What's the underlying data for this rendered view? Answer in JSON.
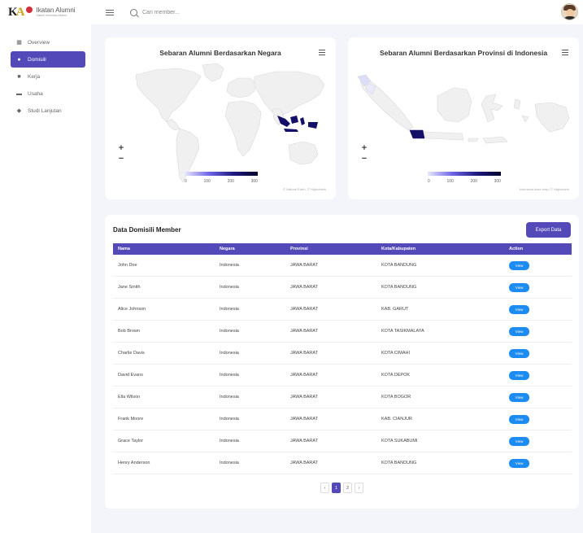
{
  "header": {
    "brand_title": "Ikatan Alumni",
    "brand_subtitle": "Sistem Informasi Alumni",
    "search_placeholder": "Cari member..."
  },
  "sidebar": {
    "items": [
      {
        "label": "Overview",
        "icon": "grid-icon"
      },
      {
        "label": "Domisili",
        "icon": "globe-icon"
      },
      {
        "label": "Kerja",
        "icon": "briefcase-icon"
      },
      {
        "label": "Usaha",
        "icon": "store-icon"
      },
      {
        "label": "Studi Lanjutan",
        "icon": "graduation-icon"
      }
    ],
    "active_index": 1
  },
  "map_world": {
    "title": "Sebaran Alumni Berdasarkan Negara",
    "zoom_in": "+",
    "zoom_out": "−",
    "legend_ticks": [
      "0",
      "100",
      "200",
      "300"
    ],
    "credits": "© Natural Earth, © Highcharts"
  },
  "map_indonesia": {
    "title": "Sebaran Alumni Berdasarkan Provinsi di Indonesia",
    "zoom_in": "+",
    "zoom_out": "−",
    "legend_ticks": [
      "0",
      "100",
      "200",
      "300"
    ],
    "credits": "Indonesia base map, © Highcharts"
  },
  "table": {
    "title": "Data Domisili Member",
    "export_label": "Export Data",
    "columns": [
      "Nama",
      "Negara",
      "Provinsi",
      "Kota/Kabupaten",
      "Action"
    ],
    "view_label": "View",
    "rows": [
      [
        "John Doe",
        "Indonesia",
        "JAWA BARAT",
        "KOTA BANDUNG"
      ],
      [
        "Jane Smith",
        "Indonesia",
        "JAWA BARAT",
        "KOTA BANDUNG"
      ],
      [
        "Alice Johnson",
        "Indonesia",
        "JAWA BARAT",
        "KAB. GARUT"
      ],
      [
        "Bob Brown",
        "Indonesia",
        "JAWA BARAT",
        "KOTA TASIKMALAYA"
      ],
      [
        "Charlie Davis",
        "Indonesia",
        "JAWA BARAT",
        "KOTA CIMAHI"
      ],
      [
        "David Evans",
        "Indonesia",
        "JAWA BARAT",
        "KOTA DEPOK"
      ],
      [
        "Ella Wilson",
        "Indonesia",
        "JAWA BARAT",
        "KOTA BOGOR"
      ],
      [
        "Frank Moore",
        "Indonesia",
        "JAWA BARAT",
        "KAB. CIANJUR"
      ],
      [
        "Grace Taylor",
        "Indonesia",
        "JAWA BARAT",
        "KOTA SUKABUMI"
      ],
      [
        "Henry Anderson",
        "Indonesia",
        "JAWA BARAT",
        "KOTA BANDUNG"
      ]
    ]
  },
  "pagination": {
    "prev": "‹",
    "pages": [
      "1",
      "2"
    ],
    "next": "›",
    "current": "1"
  },
  "colors": {
    "primary": "#5349b8",
    "view_button": "#1d8cf2",
    "map_highlight": "#1e1a80"
  }
}
